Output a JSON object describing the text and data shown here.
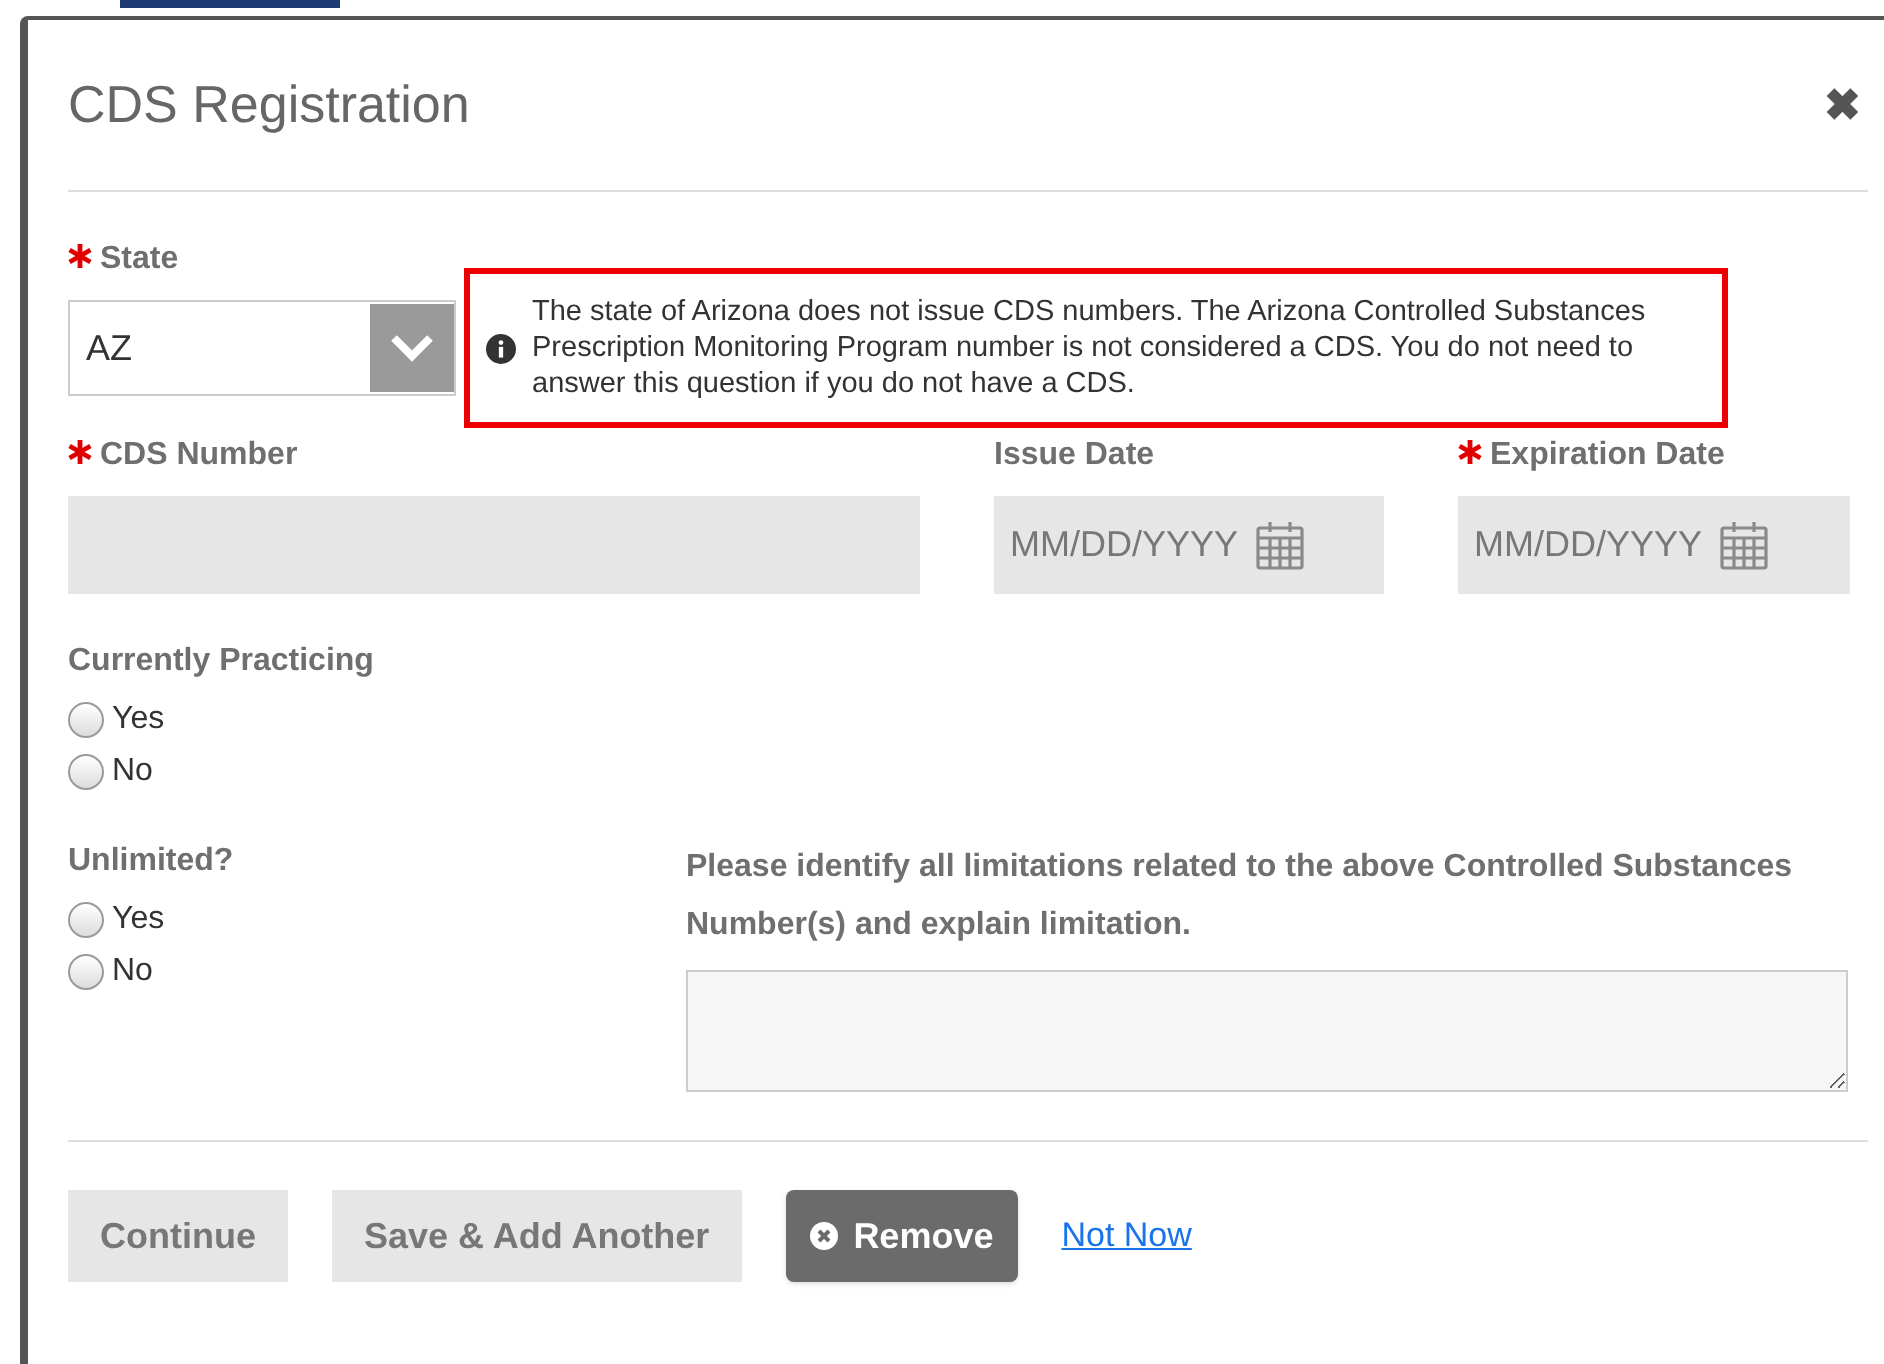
{
  "dialog": {
    "title": "CDS Registration",
    "close": "✖"
  },
  "state_field": {
    "label": "State",
    "required": true,
    "value": "AZ"
  },
  "notice": "The state of Arizona does not issue CDS numbers. The Arizona Controlled Substances Prescription Monitoring Program number is not considered a CDS. You do not need to answer this question if you do not have a CDS.",
  "cds_number": {
    "label": "CDS Number",
    "required": true
  },
  "issue_date": {
    "label": "Issue Date",
    "placeholder": "MM/DD/YYYY"
  },
  "expiration_date": {
    "label": "Expiration Date",
    "required": true,
    "placeholder": "MM/DD/YYYY"
  },
  "currently_practicing": {
    "label": "Currently Practicing",
    "options": [
      {
        "label": "Yes",
        "selected": false
      },
      {
        "label": "No",
        "selected": false
      }
    ]
  },
  "unlimited": {
    "label": "Unlimited?",
    "options": [
      {
        "label": "Yes",
        "selected": false
      },
      {
        "label": "No",
        "selected": false
      }
    ]
  },
  "limitations": {
    "label": "Please identify all limitations related to the above Controlled Substances Number(s) and explain limitation."
  },
  "buttons": [
    {
      "label": "Continue",
      "kind": "light"
    },
    {
      "label": "Save & Add Another",
      "kind": "light"
    },
    {
      "label": "Remove",
      "kind": "dark"
    },
    {
      "label": "Not Now",
      "kind": "link"
    }
  ]
}
